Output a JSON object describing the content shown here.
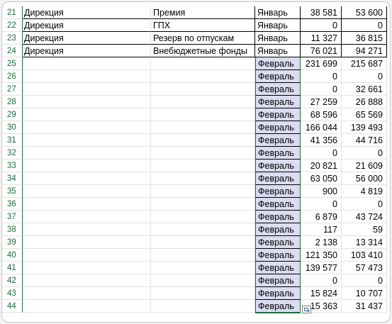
{
  "sheet": {
    "rows": [
      {
        "n": "21",
        "a": "Дирекция",
        "b": "Премия",
        "c": "Январь",
        "d": "38 581",
        "e": "53 600"
      },
      {
        "n": "22",
        "a": "Дирекция",
        "b": "ГПХ",
        "c": "Январь",
        "d": "0",
        "e": "0"
      },
      {
        "n": "23",
        "a": "Дирекция",
        "b": "Резерв по отпускам",
        "c": "Январь",
        "d": "11 327",
        "e": "36 815"
      },
      {
        "n": "24",
        "a": "Дирекция",
        "b": "Внебюджетные фонды",
        "c": "Январь",
        "d": "76 021",
        "e": "94 271"
      },
      {
        "n": "25",
        "a": "",
        "b": "",
        "c": "Февраль",
        "d": "231 699",
        "e": "215 687"
      },
      {
        "n": "26",
        "a": "",
        "b": "",
        "c": "Февраль",
        "d": "0",
        "e": "0"
      },
      {
        "n": "27",
        "a": "",
        "b": "",
        "c": "Февраль",
        "d": "0",
        "e": "32 661"
      },
      {
        "n": "28",
        "a": "",
        "b": "",
        "c": "Февраль",
        "d": "27 259",
        "e": "26 888"
      },
      {
        "n": "29",
        "a": "",
        "b": "",
        "c": "Февраль",
        "d": "68 596",
        "e": "65 569"
      },
      {
        "n": "30",
        "a": "",
        "b": "",
        "c": "Февраль",
        "d": "166 044",
        "e": "139 493"
      },
      {
        "n": "31",
        "a": "",
        "b": "",
        "c": "Февраль",
        "d": "41 356",
        "e": "44 716"
      },
      {
        "n": "32",
        "a": "",
        "b": "",
        "c": "Февраль",
        "d": "0",
        "e": "0"
      },
      {
        "n": "33",
        "a": "",
        "b": "",
        "c": "Февраль",
        "d": "20 821",
        "e": "21 609"
      },
      {
        "n": "34",
        "a": "",
        "b": "",
        "c": "Февраль",
        "d": "63 050",
        "e": "56 000"
      },
      {
        "n": "35",
        "a": "",
        "b": "",
        "c": "Февраль",
        "d": "900",
        "e": "4 819"
      },
      {
        "n": "36",
        "a": "",
        "b": "",
        "c": "Февраль",
        "d": "0",
        "e": "0"
      },
      {
        "n": "37",
        "a": "",
        "b": "",
        "c": "Февраль",
        "d": "6 879",
        "e": "43 724"
      },
      {
        "n": "38",
        "a": "",
        "b": "",
        "c": "Февраль",
        "d": "117",
        "e": "59"
      },
      {
        "n": "39",
        "a": "",
        "b": "",
        "c": "Февраль",
        "d": "2 138",
        "e": "13 314"
      },
      {
        "n": "40",
        "a": "",
        "b": "",
        "c": "Февраль",
        "d": "121 350",
        "e": "103 410"
      },
      {
        "n": "41",
        "a": "",
        "b": "",
        "c": "Февраль",
        "d": "139 577",
        "e": "57 473"
      },
      {
        "n": "42",
        "a": "",
        "b": "",
        "c": "Февраль",
        "d": "0",
        "e": "0"
      },
      {
        "n": "43",
        "a": "",
        "b": "",
        "c": "Февраль",
        "d": "15 824",
        "e": "10 707"
      },
      {
        "n": "44",
        "a": "",
        "b": "",
        "c": "Февраль",
        "d": "15 363",
        "e": "31 437"
      }
    ],
    "selection_color": "#dcdcf0",
    "grid_accent": "#1d6f42",
    "paste_options_icon": "paste-options-icon"
  }
}
